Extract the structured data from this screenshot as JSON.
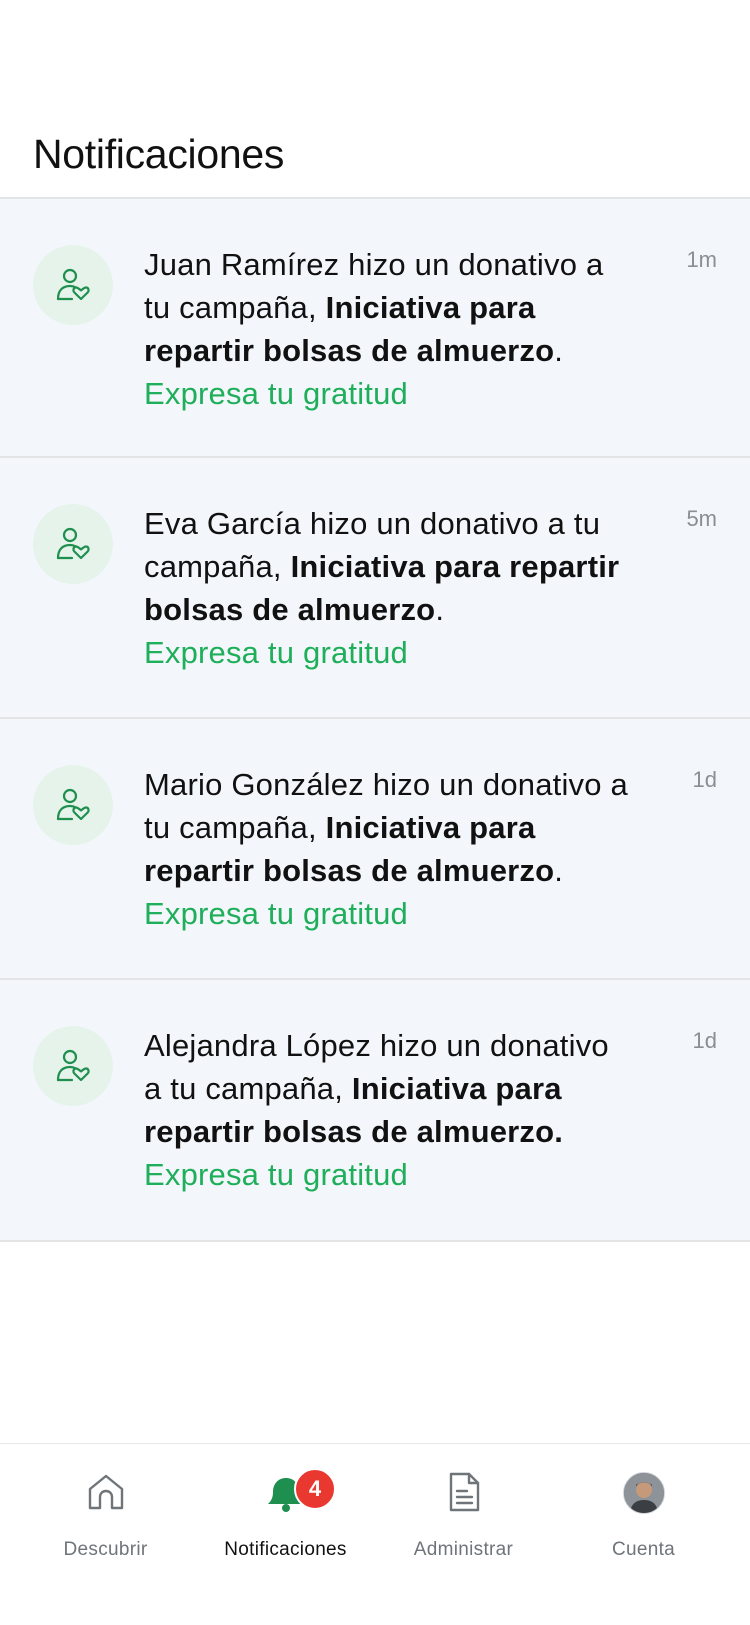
{
  "header": {
    "title": "Notificaciones"
  },
  "notifications": [
    {
      "text_start": "Juan Ramírez hizo un donativo a tu campaña, ",
      "campaign": "Iniciativa para repartir bolsas de almuerzo",
      "text_end": ".",
      "cta": "Expresa tu gratitud",
      "time": "1m"
    },
    {
      "text_start": "Eva García hizo un donativo a tu campaña, ",
      "campaign": "Iniciativa para repartir bolsas de almuerzo",
      "text_end": ".",
      "cta": "Expresa tu gratitud",
      "time": "5m"
    },
    {
      "text_start": "Mario González hizo un donativo a tu campaña, ",
      "campaign": "Iniciativa para repartir bolsas de almuerzo",
      "text_end": ".",
      "cta": "Expresa tu gratitud",
      "time": "1d"
    },
    {
      "text_start": "Alejandra López hizo un donativo a tu campaña, ",
      "campaign": "Iniciativa para repartir bolsas de almuerzo.",
      "text_end": "",
      "cta": "Expresa tu gratitud",
      "time": "1d"
    }
  ],
  "tabbar": {
    "tabs": [
      {
        "label": "Descubrir",
        "icon": "home-icon"
      },
      {
        "label": "Notificaciones",
        "icon": "bell-icon",
        "badge": "4"
      },
      {
        "label": "Administrar",
        "icon": "document-icon"
      },
      {
        "label": "Cuenta",
        "icon": "profile-avatar"
      }
    ]
  },
  "colors": {
    "accent_green": "#1fae5a",
    "row_background": "#f3f7fb",
    "badge_red": "#e8382f"
  }
}
